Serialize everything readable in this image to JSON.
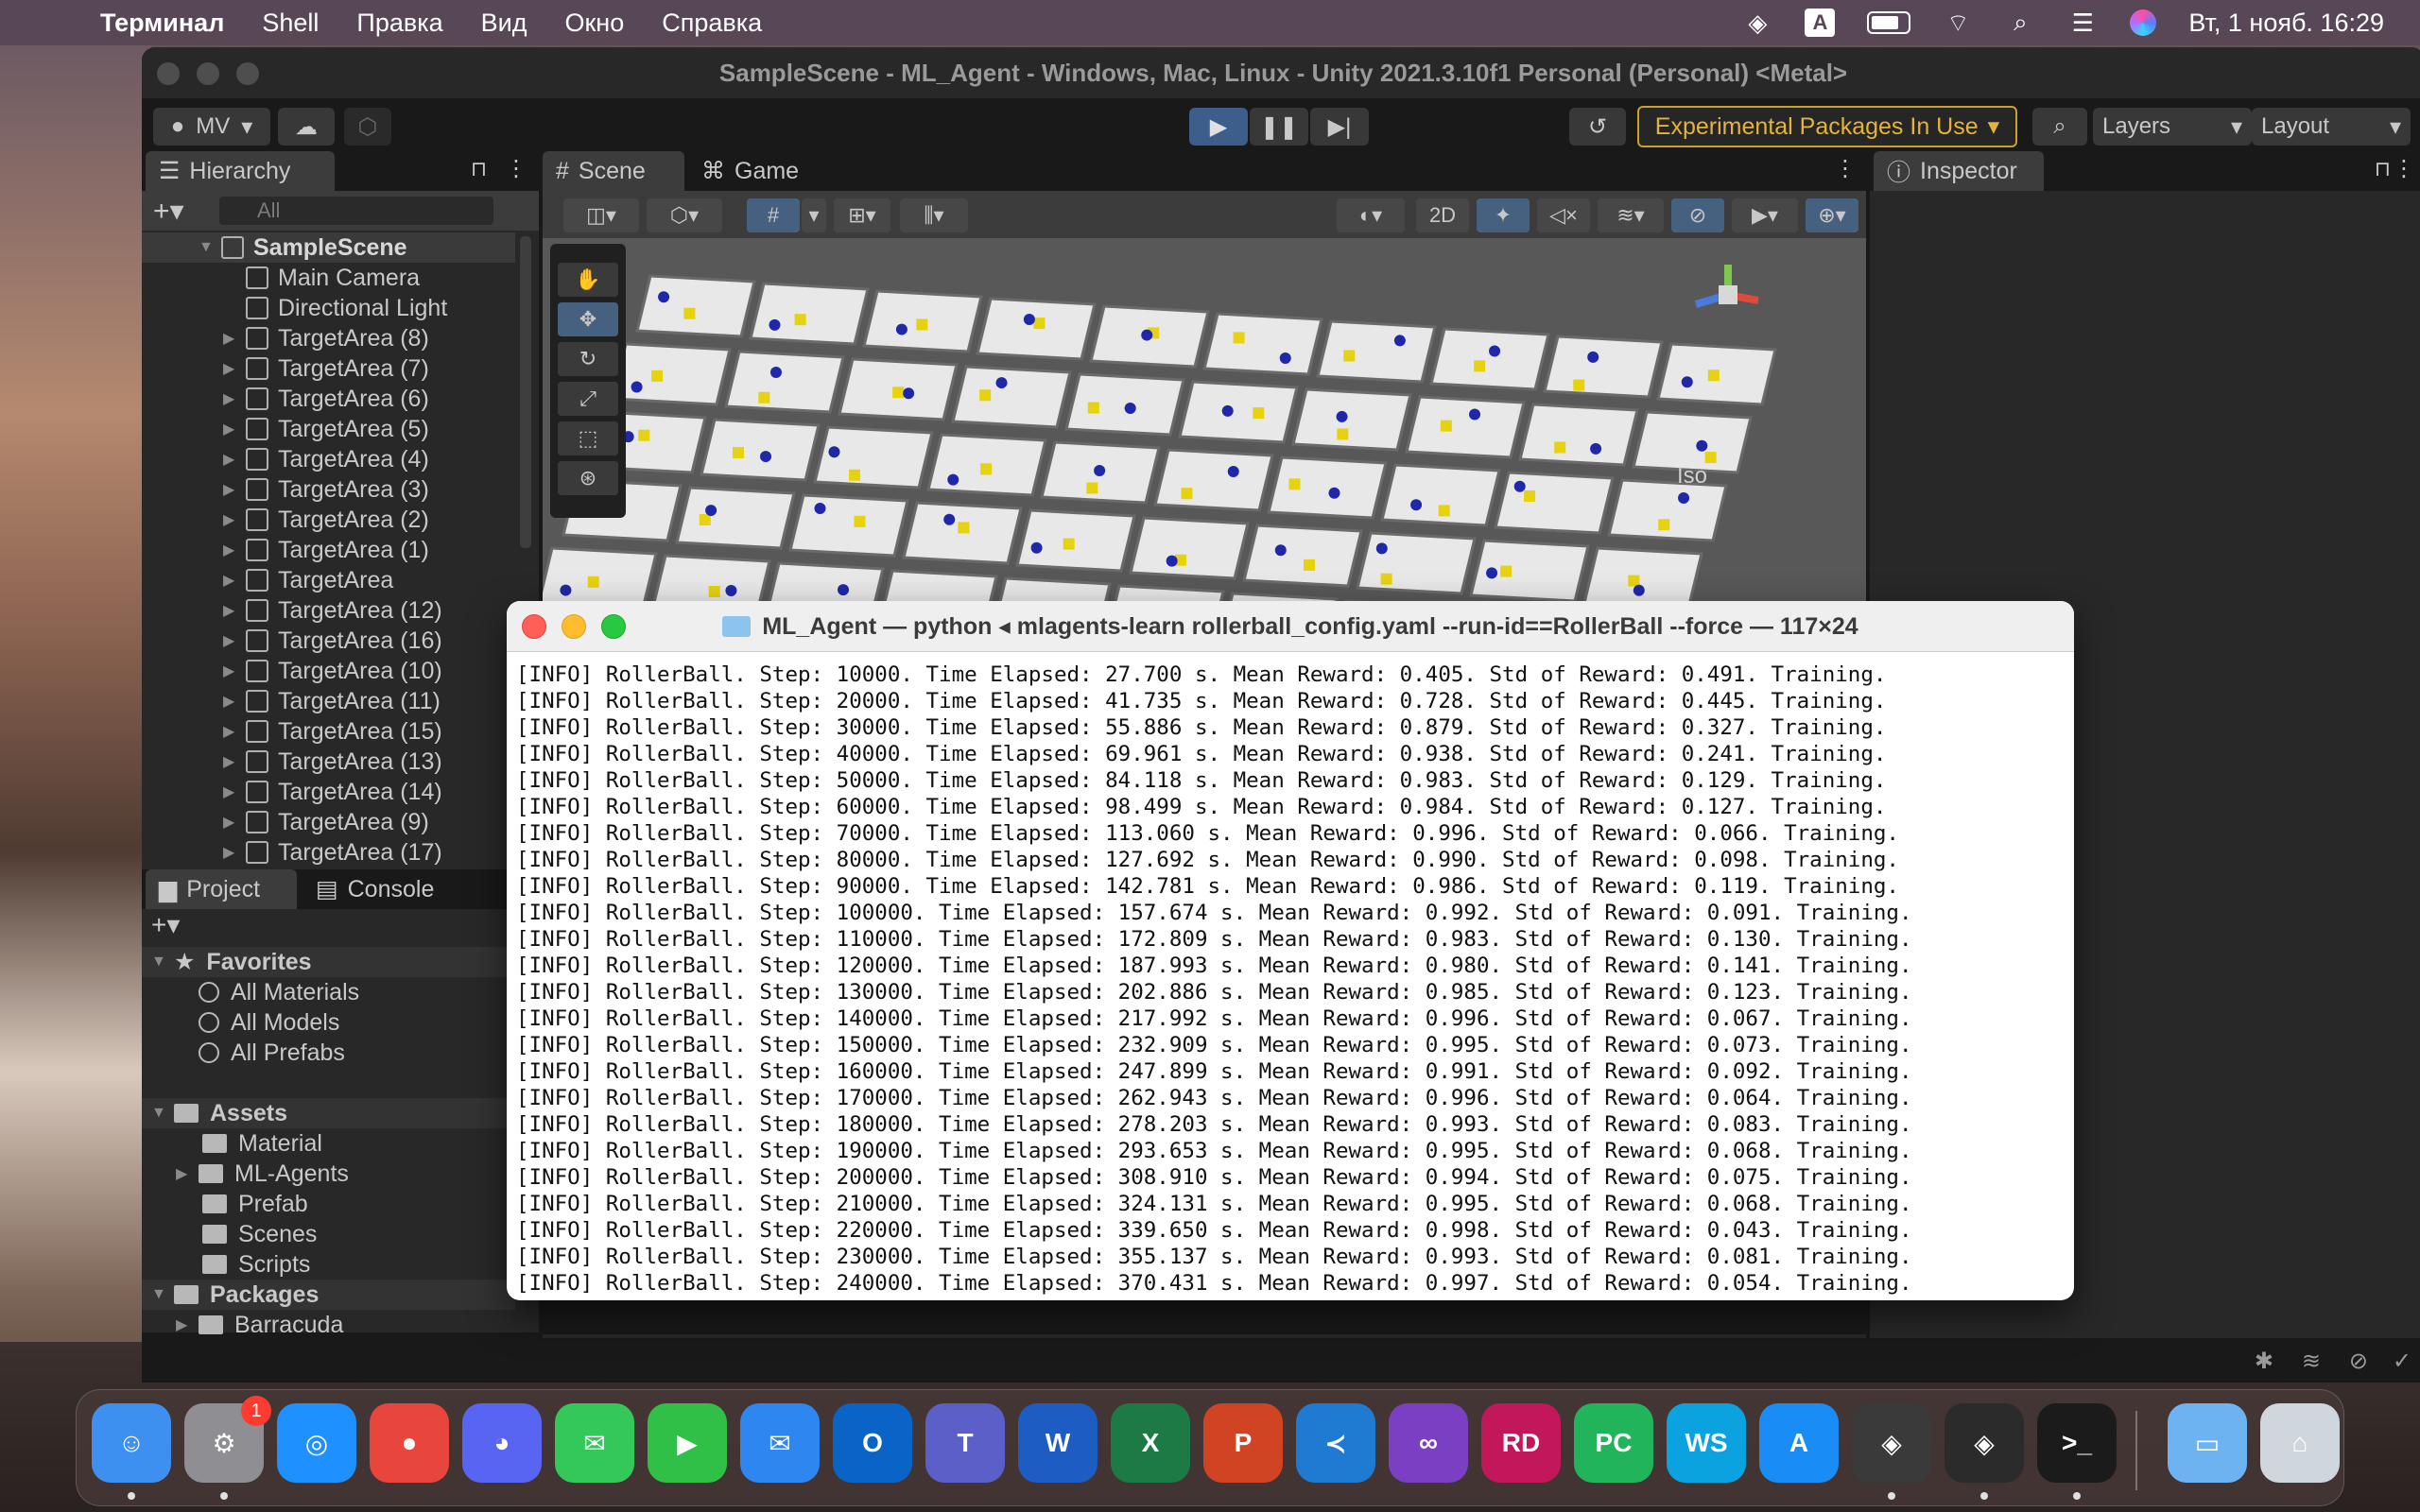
{
  "menubar": {
    "app": "Терминал",
    "menus": [
      "Shell",
      "Правка",
      "Вид",
      "Окно",
      "Справка"
    ],
    "input_source": "A",
    "clock": "Вт, 1 нояб.  16:29"
  },
  "unity": {
    "window_title": "SampleScene - ML_Agent - Windows, Mac, Linux - Unity 2021.3.10f1 Personal (Personal) <Metal>",
    "account_label": "MV",
    "experimental_label": "Experimental Packages In Use",
    "layers_label": "Layers",
    "layout_label": "Layout",
    "tabs": {
      "hierarchy": "Hierarchy",
      "scene": "Scene",
      "game": "Game",
      "inspector": "Inspector",
      "project": "Project",
      "console": "Console"
    },
    "hierarchy_search_placeholder": "All",
    "scene_2d_label": "2D",
    "scene_iso_label": "Iso",
    "hierarchy": [
      {
        "label": "SampleScene",
        "kind": "root"
      },
      {
        "label": "Main Camera",
        "kind": "leaf"
      },
      {
        "label": "Directional Light",
        "kind": "leaf"
      },
      {
        "label": "TargetArea (8)",
        "kind": "node"
      },
      {
        "label": "TargetArea (7)",
        "kind": "node"
      },
      {
        "label": "TargetArea (6)",
        "kind": "node"
      },
      {
        "label": "TargetArea (5)",
        "kind": "node"
      },
      {
        "label": "TargetArea (4)",
        "kind": "node"
      },
      {
        "label": "TargetArea (3)",
        "kind": "node"
      },
      {
        "label": "TargetArea (2)",
        "kind": "node"
      },
      {
        "label": "TargetArea (1)",
        "kind": "node"
      },
      {
        "label": "TargetArea",
        "kind": "node"
      },
      {
        "label": "TargetArea (12)",
        "kind": "node"
      },
      {
        "label": "TargetArea (16)",
        "kind": "node"
      },
      {
        "label": "TargetArea (10)",
        "kind": "node"
      },
      {
        "label": "TargetArea (11)",
        "kind": "node"
      },
      {
        "label": "TargetArea (15)",
        "kind": "node"
      },
      {
        "label": "TargetArea (13)",
        "kind": "node"
      },
      {
        "label": "TargetArea (14)",
        "kind": "node"
      },
      {
        "label": "TargetArea (9)",
        "kind": "node"
      },
      {
        "label": "TargetArea (17)",
        "kind": "node"
      }
    ],
    "project": [
      {
        "label": "Favorites",
        "kind": "head-star"
      },
      {
        "label": "All Materials",
        "kind": "search"
      },
      {
        "label": "All Models",
        "kind": "search"
      },
      {
        "label": "All Prefabs",
        "kind": "search"
      },
      {
        "label": "",
        "kind": "spacer"
      },
      {
        "label": "Assets",
        "kind": "head-folder"
      },
      {
        "label": "Material",
        "kind": "folder"
      },
      {
        "label": "ML-Agents",
        "kind": "folder-node"
      },
      {
        "label": "Prefab",
        "kind": "folder"
      },
      {
        "label": "Scenes",
        "kind": "folder"
      },
      {
        "label": "Scripts",
        "kind": "folder"
      },
      {
        "label": "Packages",
        "kind": "head-folder"
      },
      {
        "label": "Barracuda",
        "kind": "folder-node"
      }
    ]
  },
  "terminal": {
    "title": "ML_Agent — python ◂ mlagents-learn rollerball_config.yaml --run-id==RollerBall --force — 117×24",
    "lines": [
      "[INFO] RollerBall. Step: 10000. Time Elapsed: 27.700 s. Mean Reward: 0.405. Std of Reward: 0.491. Training.",
      "[INFO] RollerBall. Step: 20000. Time Elapsed: 41.735 s. Mean Reward: 0.728. Std of Reward: 0.445. Training.",
      "[INFO] RollerBall. Step: 30000. Time Elapsed: 55.886 s. Mean Reward: 0.879. Std of Reward: 0.327. Training.",
      "[INFO] RollerBall. Step: 40000. Time Elapsed: 69.961 s. Mean Reward: 0.938. Std of Reward: 0.241. Training.",
      "[INFO] RollerBall. Step: 50000. Time Elapsed: 84.118 s. Mean Reward: 0.983. Std of Reward: 0.129. Training.",
      "[INFO] RollerBall. Step: 60000. Time Elapsed: 98.499 s. Mean Reward: 0.984. Std of Reward: 0.127. Training.",
      "[INFO] RollerBall. Step: 70000. Time Elapsed: 113.060 s. Mean Reward: 0.996. Std of Reward: 0.066. Training.",
      "[INFO] RollerBall. Step: 80000. Time Elapsed: 127.692 s. Mean Reward: 0.990. Std of Reward: 0.098. Training.",
      "[INFO] RollerBall. Step: 90000. Time Elapsed: 142.781 s. Mean Reward: 0.986. Std of Reward: 0.119. Training.",
      "[INFO] RollerBall. Step: 100000. Time Elapsed: 157.674 s. Mean Reward: 0.992. Std of Reward: 0.091. Training.",
      "[INFO] RollerBall. Step: 110000. Time Elapsed: 172.809 s. Mean Reward: 0.983. Std of Reward: 0.130. Training.",
      "[INFO] RollerBall. Step: 120000. Time Elapsed: 187.993 s. Mean Reward: 0.980. Std of Reward: 0.141. Training.",
      "[INFO] RollerBall. Step: 130000. Time Elapsed: 202.886 s. Mean Reward: 0.985. Std of Reward: 0.123. Training.",
      "[INFO] RollerBall. Step: 140000. Time Elapsed: 217.992 s. Mean Reward: 0.996. Std of Reward: 0.067. Training.",
      "[INFO] RollerBall. Step: 150000. Time Elapsed: 232.909 s. Mean Reward: 0.995. Std of Reward: 0.073. Training.",
      "[INFO] RollerBall. Step: 160000. Time Elapsed: 247.899 s. Mean Reward: 0.991. Std of Reward: 0.092. Training.",
      "[INFO] RollerBall. Step: 170000. Time Elapsed: 262.943 s. Mean Reward: 0.996. Std of Reward: 0.064. Training.",
      "[INFO] RollerBall. Step: 180000. Time Elapsed: 278.203 s. Mean Reward: 0.993. Std of Reward: 0.083. Training.",
      "[INFO] RollerBall. Step: 190000. Time Elapsed: 293.653 s. Mean Reward: 0.995. Std of Reward: 0.068. Training.",
      "[INFO] RollerBall. Step: 200000. Time Elapsed: 308.910 s. Mean Reward: 0.994. Std of Reward: 0.075. Training.",
      "[INFO] RollerBall. Step: 210000. Time Elapsed: 324.131 s. Mean Reward: 0.995. Std of Reward: 0.068. Training.",
      "[INFO] RollerBall. Step: 220000. Time Elapsed: 339.650 s. Mean Reward: 0.998. Std of Reward: 0.043. Training.",
      "[INFO] RollerBall. Step: 230000. Time Elapsed: 355.137 s. Mean Reward: 0.993. Std of Reward: 0.081. Training.",
      "[INFO] RollerBall. Step: 240000. Time Elapsed: 370.431 s. Mean Reward: 0.997. Std of Reward: 0.054. Training."
    ]
  },
  "dock": [
    {
      "name": "finder",
      "text": "☺",
      "color": "#3d8ff0",
      "running": true
    },
    {
      "name": "system-settings",
      "text": "⚙",
      "color": "#8e8e93",
      "running": true,
      "badge": "1"
    },
    {
      "name": "safari",
      "text": "◎",
      "color": "#1e90ff",
      "running": false
    },
    {
      "name": "chrome",
      "text": "●",
      "color": "#e8453c",
      "running": false
    },
    {
      "name": "discord",
      "text": "◕",
      "color": "#5865f2",
      "running": false
    },
    {
      "name": "messages",
      "text": "✉",
      "color": "#34c759",
      "running": false
    },
    {
      "name": "facetime",
      "text": "▶",
      "color": "#30c048",
      "running": false
    },
    {
      "name": "mail",
      "text": "✉",
      "color": "#2e86f0",
      "running": false
    },
    {
      "name": "outlook",
      "text": "O",
      "color": "#0a64c8",
      "running": false
    },
    {
      "name": "teams",
      "text": "T",
      "color": "#5b5fc7",
      "running": false
    },
    {
      "name": "word",
      "text": "W",
      "color": "#1d5cc2",
      "running": false
    },
    {
      "name": "excel",
      "text": "X",
      "color": "#1d7a44",
      "running": false
    },
    {
      "name": "powerpoint",
      "text": "P",
      "color": "#d04423",
      "running": false
    },
    {
      "name": "vscode",
      "text": "≺",
      "color": "#1f7bd1",
      "running": false
    },
    {
      "name": "visual-studio",
      "text": "∞",
      "color": "#7b3fc4",
      "running": false
    },
    {
      "name": "rider",
      "text": "RD",
      "color": "#c2185b",
      "running": false
    },
    {
      "name": "pycharm",
      "text": "PC",
      "color": "#21b45a",
      "running": false
    },
    {
      "name": "webstorm",
      "text": "WS",
      "color": "#0aa3e0",
      "running": false
    },
    {
      "name": "app-store",
      "text": "A",
      "color": "#1a8cf5",
      "running": false
    },
    {
      "name": "unity-hub",
      "text": "◈",
      "color": "#3a3a3a",
      "running": true
    },
    {
      "name": "unity",
      "text": "◈",
      "color": "#2b2b2b",
      "running": true
    },
    {
      "name": "terminal",
      "text": ">_",
      "color": "#1b1b1b",
      "running": true
    },
    {
      "name": "downloads-folder",
      "text": "▭",
      "color": "#6db3f2",
      "running": false
    },
    {
      "name": "trash",
      "text": "⌂",
      "color": "#cfd6dc",
      "running": false
    }
  ]
}
